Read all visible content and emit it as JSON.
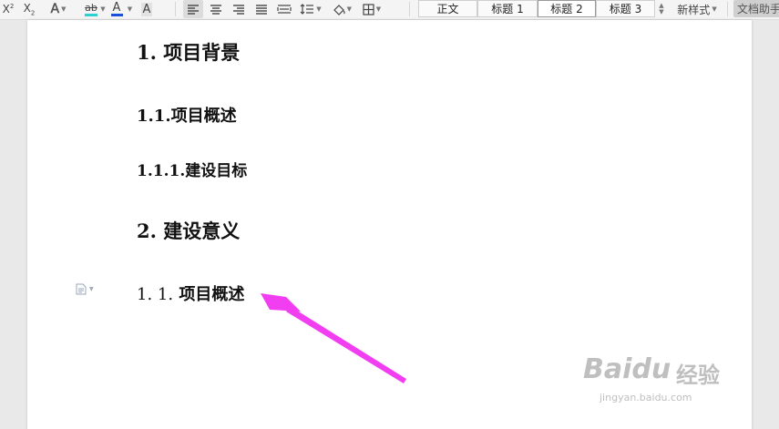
{
  "toolbar": {
    "styles": [
      {
        "label": "正文"
      },
      {
        "label": "标题 1"
      },
      {
        "label": "标题 2",
        "selected": true
      },
      {
        "label": "标题 3"
      }
    ],
    "new_style_label": "新样式",
    "doc_helper_label": "文档助手",
    "char_A_label": "A",
    "font_color_label": "A",
    "highlight_label": "ab",
    "accent_font_color": "#1a4fd6",
    "accent_highlight": "#2bd1d1"
  },
  "document": {
    "headings": [
      {
        "text": "1. 项目背景",
        "level": 1
      },
      {
        "text": "1.1.项目概述",
        "level": 2
      },
      {
        "text": "1.1.1.建设目标",
        "level": 3
      },
      {
        "text": "2. 建设意义",
        "level": 1
      },
      {
        "num": "1. 1.",
        "text": "项目概述",
        "level": 2
      }
    ]
  },
  "annotation": {
    "arrow_color": "#f03ef0"
  },
  "watermark": {
    "brand": "Baidu",
    "suffix": "经验",
    "url": "jingyan.baidu.com"
  }
}
